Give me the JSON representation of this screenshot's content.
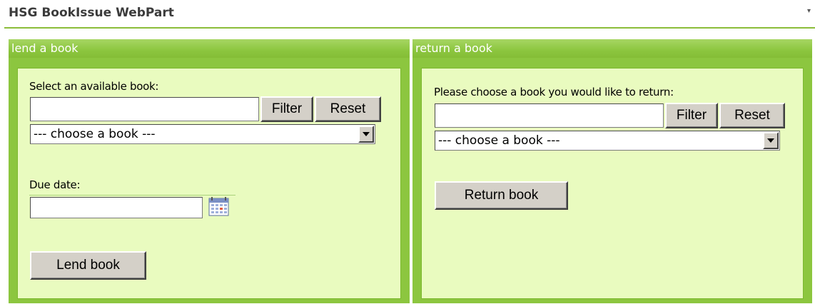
{
  "header": {
    "title": "HSG BookIssue WebPart",
    "menu_glyph": "▾"
  },
  "lend": {
    "title": "lend a book",
    "select_label": "Select an available book:",
    "filter_value": "",
    "filter_button": "Filter",
    "reset_button": "Reset",
    "dropdown_selected": "--- choose a book ---",
    "due_label": "Due date:",
    "due_value": "",
    "lend_button": "Lend book"
  },
  "return": {
    "title": "return a book",
    "select_label": "Please choose a book you would like to return:",
    "filter_value": "",
    "filter_button": "Filter",
    "reset_button": "Reset",
    "dropdown_selected": "--- choose a book ---",
    "return_button": "Return book"
  },
  "colors": {
    "accent_green": "#8cc63f",
    "panel_background": "#e9fbbf",
    "button_face": "#d4d0c8"
  }
}
